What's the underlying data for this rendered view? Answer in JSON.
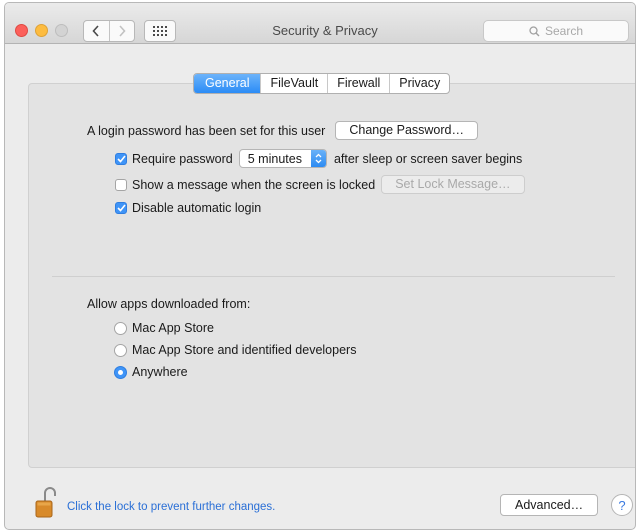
{
  "window": {
    "title": "Security & Privacy"
  },
  "search": {
    "placeholder": "Search"
  },
  "tabs": [
    {
      "label": "General",
      "active": true
    },
    {
      "label": "FileVault",
      "active": false
    },
    {
      "label": "Firewall",
      "active": false
    },
    {
      "label": "Privacy",
      "active": false
    }
  ],
  "general": {
    "login_text": "A login password has been set for this user",
    "change_password_label": "Change Password…",
    "require_password": {
      "label": "Require password",
      "checked": true,
      "delay_value": "5 minutes",
      "suffix": "after sleep or screen saver begins"
    },
    "show_message": {
      "label": "Show a message when the screen is locked",
      "checked": false,
      "button_label": "Set Lock Message…"
    },
    "disable_autologin": {
      "label": "Disable automatic login",
      "checked": true
    }
  },
  "allow_apps": {
    "heading": "Allow apps downloaded from:",
    "options": [
      {
        "label": "Mac App Store",
        "selected": false
      },
      {
        "label": "Mac App Store and identified developers",
        "selected": false
      },
      {
        "label": "Anywhere",
        "selected": true
      }
    ]
  },
  "footer": {
    "lock_text": "Click the lock to prevent further changes.",
    "advanced_label": "Advanced…",
    "help_label": "?"
  },
  "colors": {
    "accent": "#3f94f7",
    "link": "#2a6fd6"
  },
  "icons": [
    "chevron-left-icon",
    "chevron-right-icon",
    "grid-icon",
    "search-icon",
    "checkmark-icon",
    "popup-arrows-icon",
    "padlock-open-icon"
  ]
}
